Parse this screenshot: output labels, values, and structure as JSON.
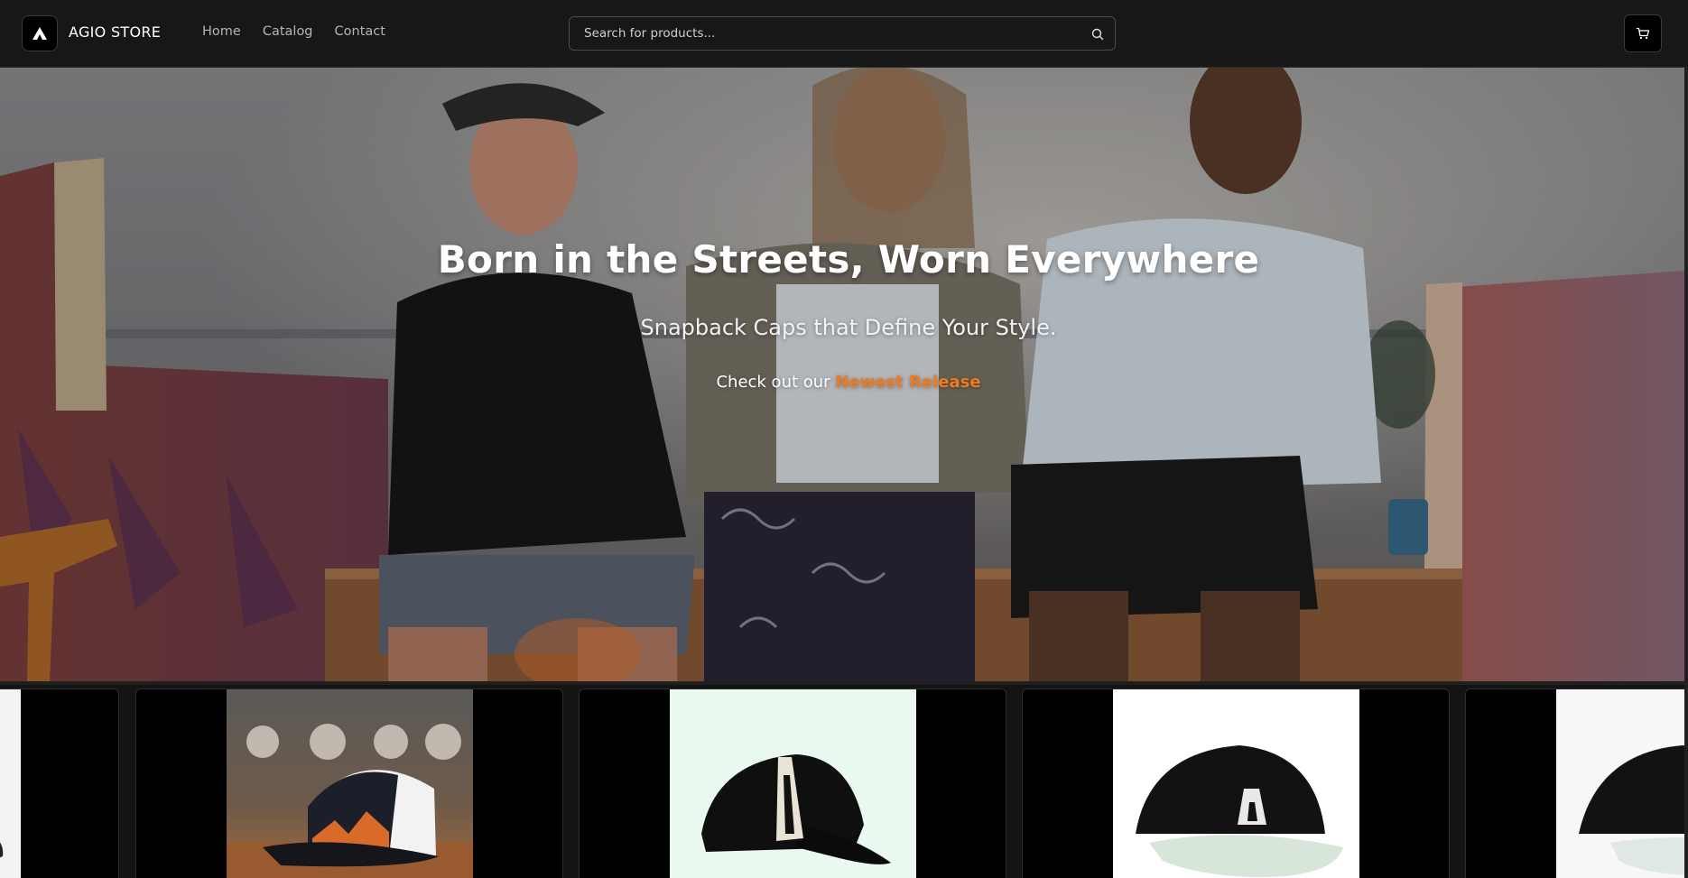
{
  "header": {
    "brand": "AGIO STORE",
    "nav": [
      "Home",
      "Catalog",
      "Contact"
    ],
    "search_placeholder": "Search for products...",
    "cart_icon": "cart-icon",
    "search_icon": "search-icon"
  },
  "hero": {
    "title": "Born in the Streets, Worn Everywhere",
    "subtitle": "Snapback Caps that Define Your Style.",
    "cta_prefix": "Check out our ",
    "cta_link": "Newest Release",
    "accent_color": "#f07a1c"
  },
  "products": {
    "count_visible": 5
  }
}
